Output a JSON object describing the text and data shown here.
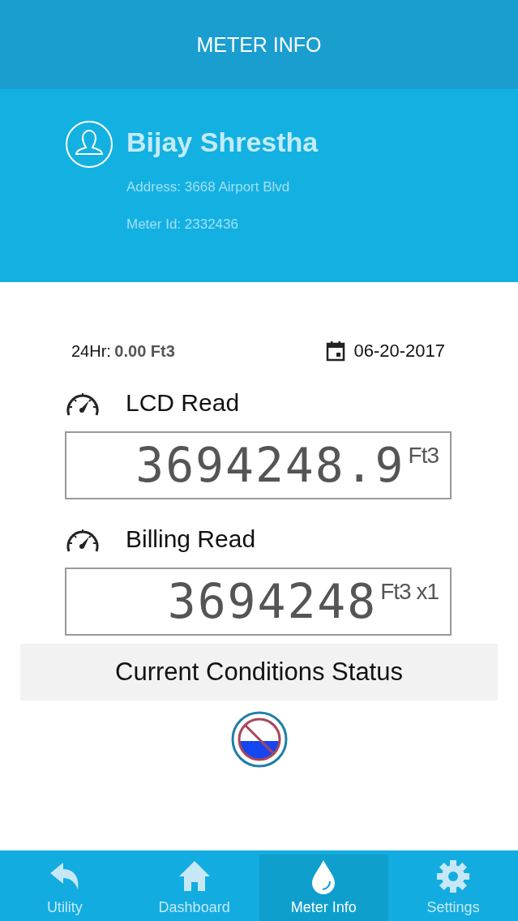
{
  "header": {
    "title": "METER INFO"
  },
  "profile": {
    "name": "Bijay Shrestha",
    "address": "Address: 3668 Airport Blvd",
    "meter_id": "Meter Id: 2332436"
  },
  "summary": {
    "label": "24Hr:",
    "value": "0.00 Ft3",
    "date": "06-20-2017"
  },
  "readings": [
    {
      "title": "LCD Read",
      "value": "3694248.9",
      "unit": "Ft3"
    },
    {
      "title": "Billing Read",
      "value": "3694248",
      "unit": "Ft3 x1"
    }
  ],
  "status": {
    "title": "Current Conditions Status"
  },
  "tabs": [
    {
      "label": "Utility",
      "kind": "back",
      "selected": false
    },
    {
      "label": "Dashboard",
      "kind": "home",
      "selected": false
    },
    {
      "label": "Meter Info",
      "kind": "drop",
      "selected": true
    },
    {
      "label": "Settings",
      "kind": "gear",
      "selected": false
    }
  ]
}
